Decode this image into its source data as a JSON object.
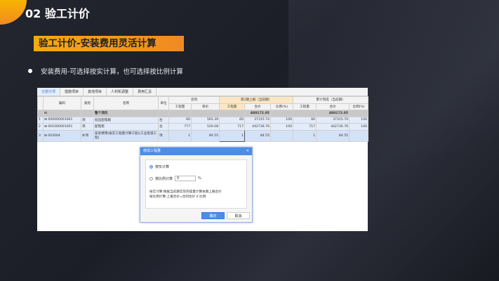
{
  "slide": {
    "title": "02 验工计价",
    "subtitle": "验工计价-安装费用灵活计算",
    "bullet": "安装费用-可选择按实计算，也可选择按比例计算"
  },
  "tabs": [
    "分部分项",
    "措施项目",
    "其他项目",
    "人材机调整",
    "费用汇总"
  ],
  "table": {
    "headers": {
      "code": "编码",
      "type": "类别",
      "name": "名称",
      "unit": "单位",
      "contract": "合同",
      "current": "第2期上报（当前期）",
      "cumulative": "累计完成（当前期）",
      "qty": "工程量",
      "price": "单价",
      "total": "合价",
      "ratio": "比例(%)"
    },
    "group": {
      "name": "整个项目",
      "current_total": "480172.05",
      "cum_total": "480172.05"
    },
    "rows": [
      {
        "n": "1",
        "code": "000000001001",
        "type": "项",
        "name": "低压配电箱",
        "unit": "台",
        "cqty": "60",
        "cprice": "565.39",
        "qty": "60",
        "total": "37315.74",
        "ratio": "100",
        "kqty": "60",
        "ktotal": "37315.74",
        "kratio": "100"
      },
      {
        "n": "2",
        "code": "001000001001",
        "type": "项",
        "name": "配电柜",
        "unit": "台",
        "cqty": "777",
        "cprice": "529.08",
        "qty": "717",
        "total": "442736.76",
        "ratio": "100",
        "kqty": "717",
        "ktotal": "442736.76",
        "kratio": "100"
      },
      {
        "n": "3",
        "code": "003004",
        "type": "补项",
        "name": "安装费用(按实工程量计算工程)(工业管道工程)",
        "unit": "项",
        "cqty": "1",
        "cprice": "84.55",
        "qty": "1",
        "total": "84.55",
        "ratio": "",
        "kqty": "1",
        "ktotal": "84.55",
        "kratio": ""
      }
    ]
  },
  "dialog": {
    "title": "修改工程量",
    "opt1": "按实计算",
    "opt2": "按比例计算",
    "ratio_value": "0",
    "percent": "%",
    "desc1": "按实计算:根据当前期实际完成量计算本期上报合价",
    "desc2": "按比例计算:上报合价=合同合价 X 比例",
    "ok": "确定",
    "cancel": "取消"
  }
}
